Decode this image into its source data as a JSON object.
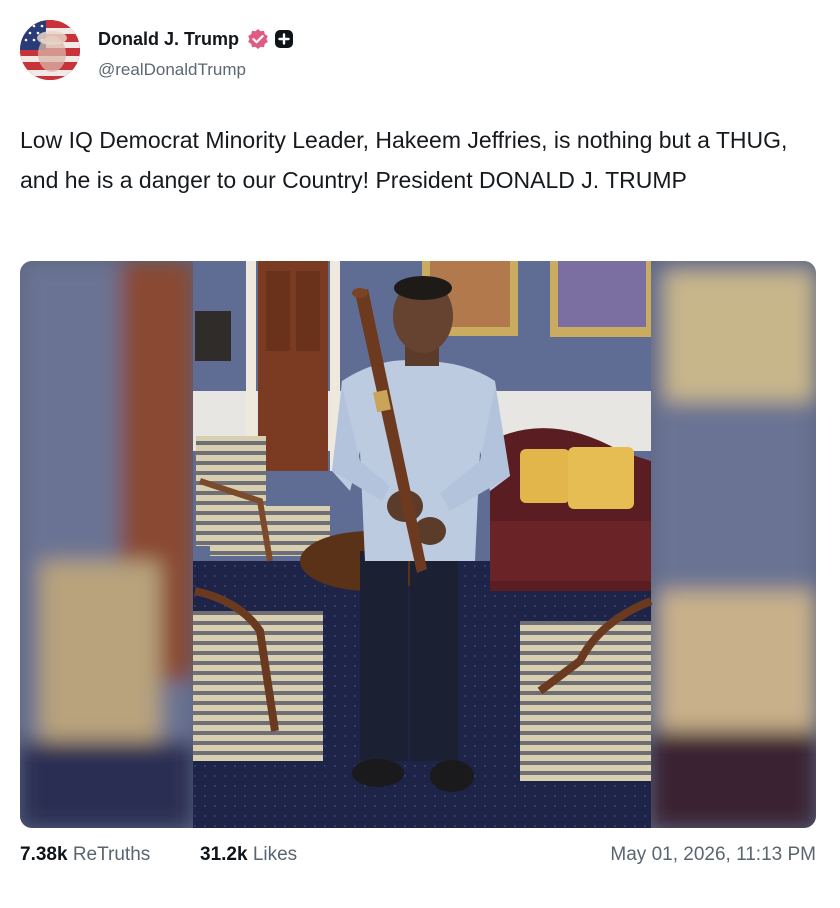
{
  "author": {
    "display_name": "Donald J. Trump",
    "handle": "@realDonaldTrump",
    "verified_icon": "verified-badge-icon",
    "badge_color": "#e05a84"
  },
  "post": {
    "text": "Low IQ Democrat Minority Leader, Hakeem Jeffries, is nothing but a THUG, and he is a danger to our Country! President DONALD J. TRUMP"
  },
  "stats": {
    "retruths_count": "7.38k",
    "retruths_label": "ReTruths",
    "likes_count": "31.2k",
    "likes_label": "Likes",
    "timestamp": "May 01, 2026, 11:13 PM"
  }
}
